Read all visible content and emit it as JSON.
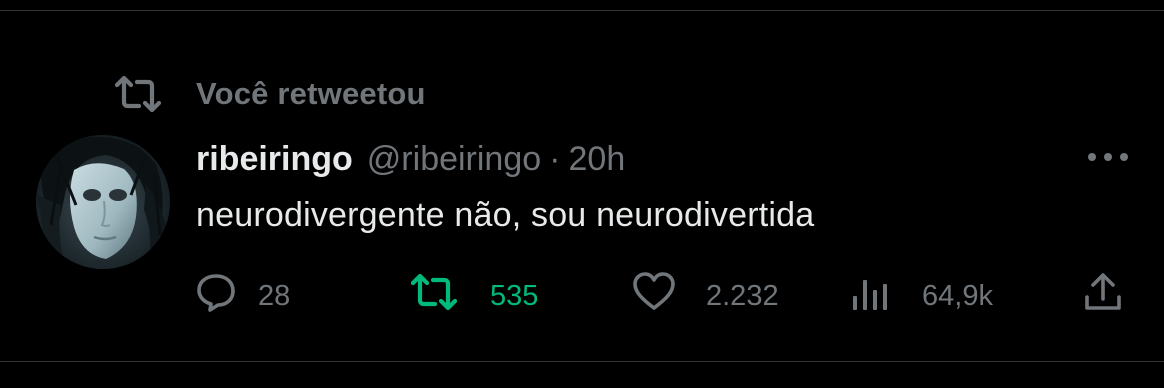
{
  "retweet_banner": {
    "text": "Você retweetou",
    "icon": "retweet-icon"
  },
  "tweet": {
    "display_name": "ribeiringo",
    "handle": "@ribeiringo",
    "separator": "·",
    "time": "20h",
    "text": "neurodivergente não, sou neurodivertida",
    "avatar_icon": "avatar"
  },
  "actions": {
    "reply": {
      "icon": "reply-icon",
      "count": "28"
    },
    "retweet": {
      "icon": "retweet-icon",
      "count": "535",
      "active": true
    },
    "like": {
      "icon": "heart-icon",
      "count": "2.232"
    },
    "views": {
      "icon": "views-icon",
      "count": "64,9k"
    },
    "share": {
      "icon": "share-icon"
    }
  },
  "more_icon": "more-icon",
  "colors": {
    "background": "#000000",
    "text_primary": "#e7e9ea",
    "text_secondary": "#71767b",
    "retweet_green": "#00ba7c",
    "divider": "#2f3336"
  }
}
